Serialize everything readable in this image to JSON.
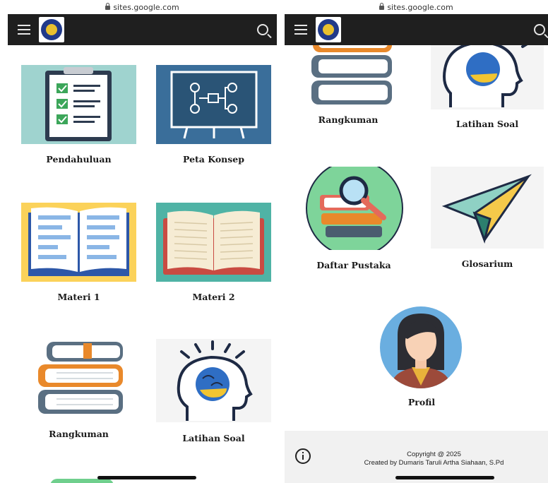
{
  "browser": {
    "url": "sites.google.com"
  },
  "left_tiles": [
    {
      "label": "Pendahuluan"
    },
    {
      "label": "Peta Konsep"
    },
    {
      "label": "Materi 1"
    },
    {
      "label": "Materi 2"
    },
    {
      "label": "Rangkuman"
    },
    {
      "label": "Latihan Soal"
    }
  ],
  "right_tiles": [
    {
      "label": "Rangkuman"
    },
    {
      "label": "Latihan Soal"
    },
    {
      "label": "Daftar Pustaka"
    },
    {
      "label": "Glosarium"
    },
    {
      "label": "Profil"
    }
  ],
  "footer": {
    "line1": "Copyright @ 2025",
    "line2": "Created by Dumaris Taruli Artha Siahaan, S.Pd"
  },
  "icons": [
    "menu-icon",
    "site-logo",
    "search-icon",
    "info-icon"
  ],
  "colors": {
    "appbar": "#1f1f1f",
    "footer": "#f1f1f1"
  }
}
